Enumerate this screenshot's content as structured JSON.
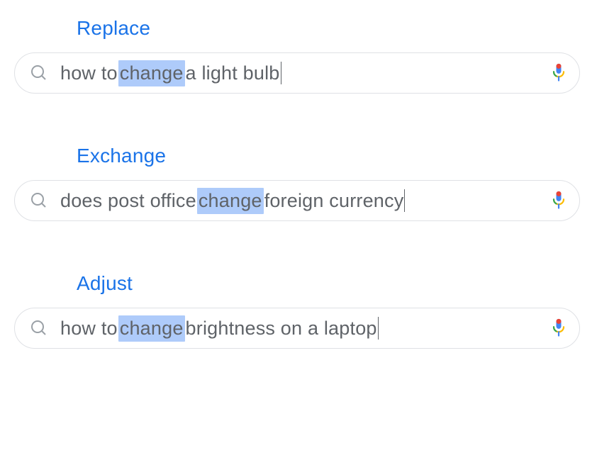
{
  "examples": [
    {
      "label": "Replace",
      "query_pre": "how to ",
      "query_highlight": "change",
      "query_post": " a light bulb"
    },
    {
      "label": "Exchange",
      "query_pre": "does post office ",
      "query_highlight": "change",
      "query_post": " foreign currency"
    },
    {
      "label": "Adjust",
      "query_pre": "how to ",
      "query_highlight": "change",
      "query_post": " brightness on a laptop"
    }
  ],
  "colors": {
    "label": "#1a73e8",
    "highlight_bg": "#aecbfa",
    "text": "#5f6368"
  }
}
